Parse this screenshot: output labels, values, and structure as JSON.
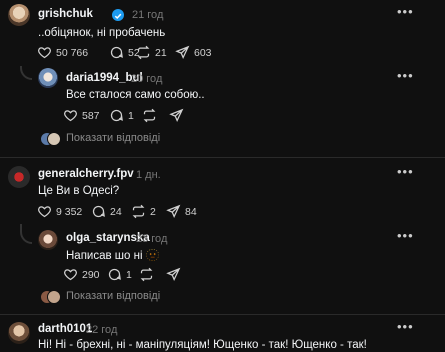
{
  "posts": [
    {
      "username": "grishchuk",
      "verified": true,
      "time": "21 год",
      "text": "..обіцянок, ні пробачень",
      "likes": "50 766",
      "comments": "52",
      "reposts": "21",
      "shares": "603",
      "reply": {
        "username": "daria1994_bul",
        "time": "20 год",
        "text": "Все сталося само собою..",
        "likes": "587",
        "comments": "1"
      },
      "show_replies": "Показати відповіді"
    },
    {
      "username": "generalcherry.fpv",
      "time": "1 дн.",
      "text": "Це Ви в Одесі?",
      "likes": "9 352",
      "comments": "24",
      "reposts": "2",
      "shares": "84",
      "reply": {
        "username": "olga_starynska",
        "time": "23 год",
        "text": "Написав шо ні 🫥",
        "likes": "290",
        "comments": "1"
      },
      "show_replies": "Показати відповіді"
    },
    {
      "username": "darth0101",
      "time": "22 год",
      "text": "Ні! Ні - брехні, ні - маніпуляціям! Ющенко - так! Ющенко - так!"
    }
  ],
  "colors": {
    "background": "#101010",
    "text": "#f3f5f7",
    "muted": "#777777",
    "verified": "#1d9bf0"
  }
}
